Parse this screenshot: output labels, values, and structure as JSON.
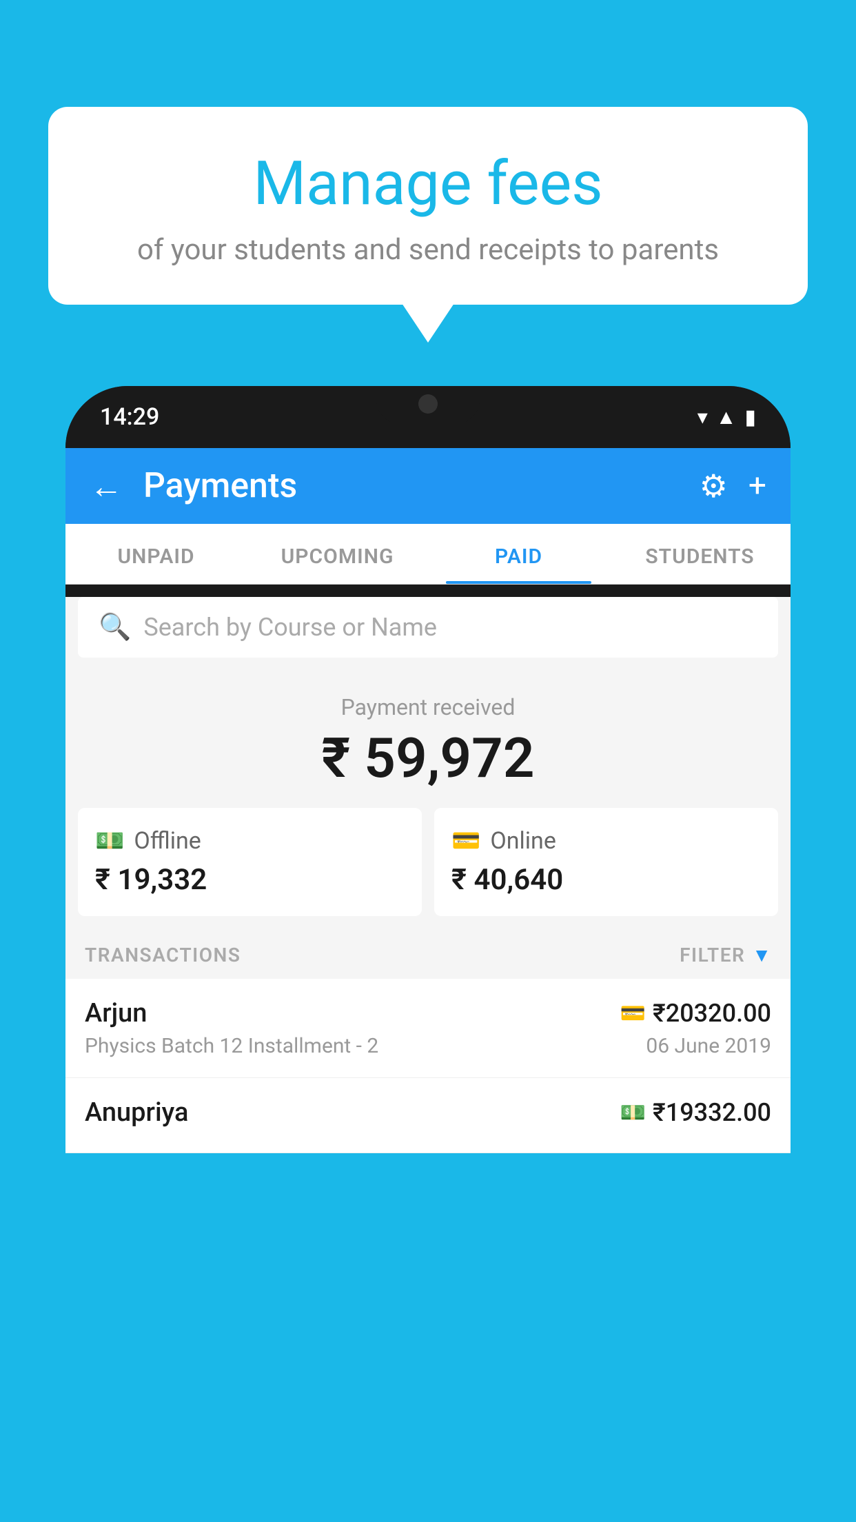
{
  "background": {
    "color": "#1ab8e8"
  },
  "speech_bubble": {
    "title": "Manage fees",
    "subtitle": "of your students and send receipts to parents"
  },
  "status_bar": {
    "time": "14:29"
  },
  "app_bar": {
    "title": "Payments",
    "back_label": "←",
    "gear_symbol": "⚙",
    "plus_symbol": "+"
  },
  "tabs": [
    {
      "label": "UNPAID",
      "active": false
    },
    {
      "label": "UPCOMING",
      "active": false
    },
    {
      "label": "PAID",
      "active": true
    },
    {
      "label": "STUDENTS",
      "active": false
    }
  ],
  "search": {
    "placeholder": "Search by Course or Name"
  },
  "payment_summary": {
    "label": "Payment received",
    "amount": "₹ 59,972",
    "offline_label": "Offline",
    "offline_amount": "₹ 19,332",
    "online_label": "Online",
    "online_amount": "₹ 40,640"
  },
  "transactions_section": {
    "label": "TRANSACTIONS",
    "filter_label": "FILTER"
  },
  "transactions": [
    {
      "name": "Arjun",
      "payment_type_icon": "💳",
      "amount": "₹20320.00",
      "description": "Physics Batch 12 Installment - 2",
      "date": "06 June 2019"
    },
    {
      "name": "Anupriya",
      "payment_type_icon": "💵",
      "amount": "₹19332.00",
      "description": "",
      "date": ""
    }
  ]
}
